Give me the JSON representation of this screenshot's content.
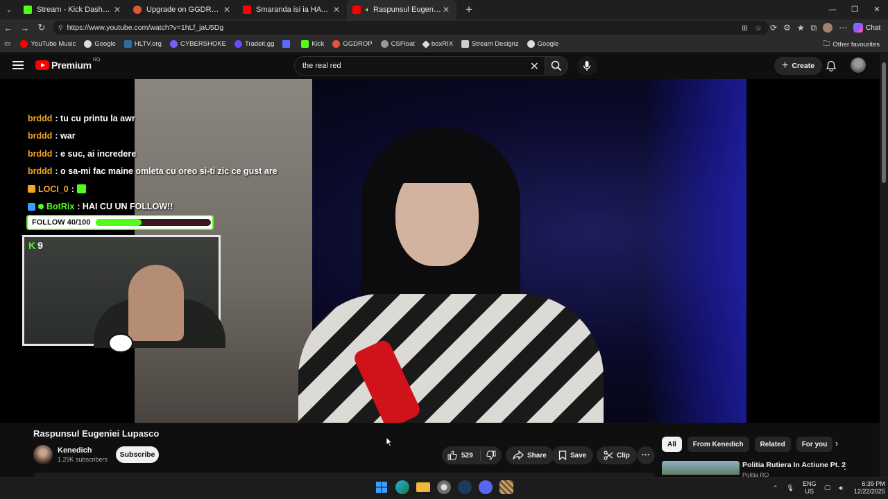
{
  "browser": {
    "tabs": [
      {
        "label": "Stream - Kick Dashboard",
        "icon": "kick-icon",
        "color": "#53fc18",
        "active": false
      },
      {
        "label": "Upgrade on GGDROP!",
        "icon": "ggdrop-icon",
        "color": "#e5533d",
        "active": false
      },
      {
        "label": "Smaranda isi ia HATE - YouTube",
        "icon": "youtube-icon",
        "color": "#ff0000",
        "active": false
      },
      {
        "label": "Raspunsul Eugeniei Lupasco",
        "icon": "youtube-audio-icon",
        "color": "#ff0000",
        "active": true
      }
    ],
    "url": "https://www.youtube.com/watch?v=1hLf_jaU5Dg",
    "copilot_label": "Chat",
    "bookmarks": [
      {
        "label": "YouTube Music",
        "color": "#ff0000"
      },
      {
        "label": "Google",
        "color": "#4285f4"
      },
      {
        "label": "HLTV.org",
        "color": "#2d6da3"
      },
      {
        "label": "CYBERSHOKE",
        "color": "#7b5cff"
      },
      {
        "label": "Tradeit.gg",
        "color": "#6a4cff"
      },
      {
        "label": "",
        "color": "#5a6aff"
      },
      {
        "label": "Kick",
        "color": "#53fc18"
      },
      {
        "label": "GGDROP",
        "color": "#e5533d"
      },
      {
        "label": "CSFloat",
        "color": "#999999"
      },
      {
        "label": "boxRIX",
        "color": "#dddddd"
      },
      {
        "label": "Stream Designz",
        "color": "#cccccc"
      },
      {
        "label": "Google",
        "color": "#4285f4"
      }
    ],
    "other_favourites": "Other favourites"
  },
  "youtube": {
    "logo_text": "Premium",
    "country": "RO",
    "search_value": "the real red",
    "create_label": "Create"
  },
  "overlay": {
    "chat": [
      {
        "user": "brddd",
        "text": " : tu cu printu la awr",
        "user_color": "#f5a623"
      },
      {
        "user": "brddd",
        "text": " : war",
        "user_color": "#f5a623"
      },
      {
        "user": "brddd",
        "text": " : e suc, ai incredere",
        "user_color": "#f5a623"
      },
      {
        "user": "brddd",
        "text": " : o sa-mi fac maine omleta cu oreo si-ti zic ce gust are",
        "user_color": "#f5a623"
      },
      {
        "user": "LOCI_0",
        "text": " : ",
        "user_color": "#f5a623"
      },
      {
        "user": "BotRix",
        "text": " : HAI CU UN FOLLOW!!",
        "user_color": "#53fc18"
      }
    ],
    "follow_label": "FOLLOW 40/100",
    "follow_progress": 0.4,
    "cam_count": "9"
  },
  "video": {
    "title": "Raspunsul Eugeniei Lupasco",
    "channel": "Kenedich",
    "subscribers": "1.29K subscribers",
    "subscribe_label": "Subscribe",
    "likes": "529",
    "share_label": "Share",
    "save_label": "Save",
    "clip_label": "Clip"
  },
  "sidebar": {
    "chips": [
      "All",
      "From Kenedich",
      "Related",
      "For you"
    ],
    "rec_title": "Politia Rutiera In Actiune Pt. 2",
    "rec_channel": "Politia RO"
  },
  "taskbar": {
    "lang_line1": "ENG",
    "lang_line2": "US",
    "time": "6:39 PM",
    "date": "12/22/2025"
  }
}
